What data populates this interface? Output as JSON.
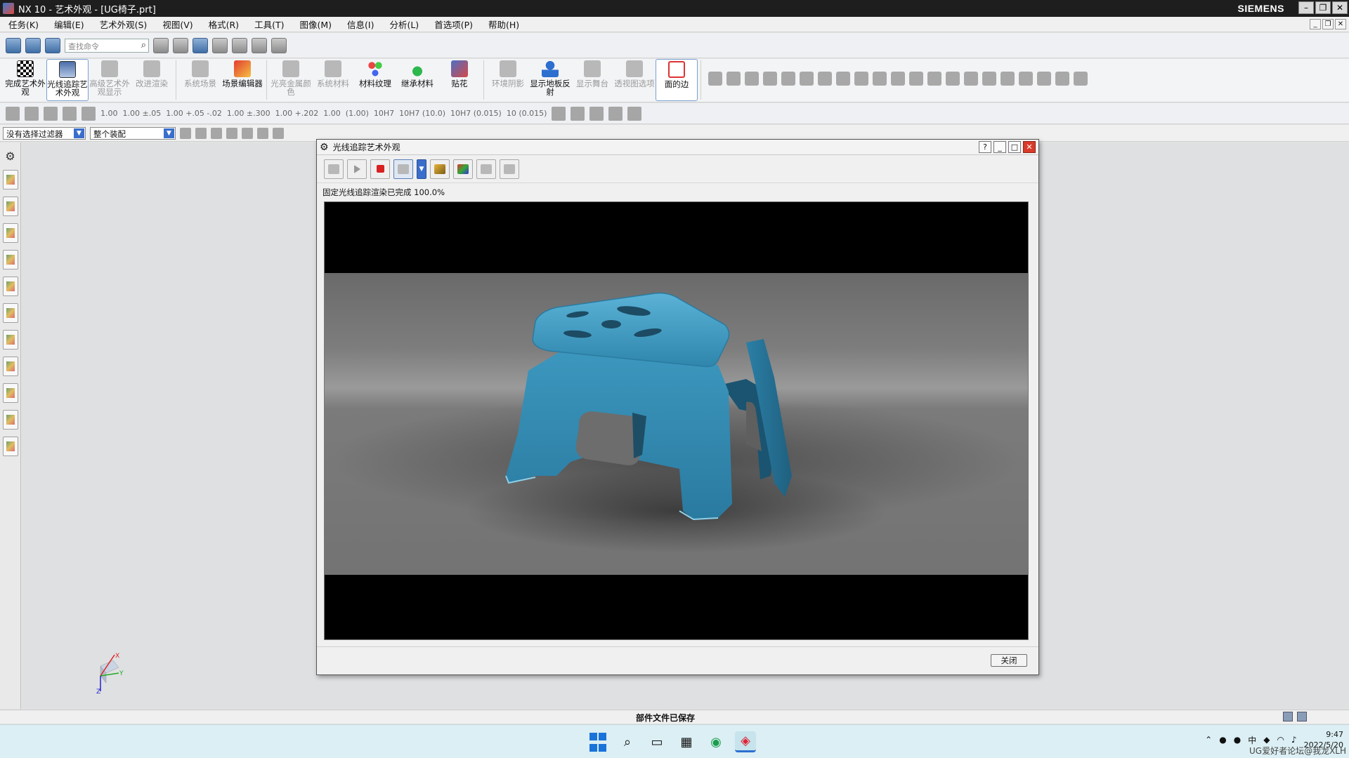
{
  "window": {
    "title": "NX 10 - 艺术外观 - [UG椅子.prt]",
    "brand": "SIEMENS"
  },
  "menu": [
    "任务(K)",
    "编辑(E)",
    "艺术外观(S)",
    "视图(V)",
    "格式(R)",
    "工具(T)",
    "图像(M)",
    "信息(I)",
    "分析(L)",
    "首选项(P)",
    "帮助(H)"
  ],
  "quick": {
    "search_placeholder": "查找命令"
  },
  "ribbon": {
    "buttons": [
      {
        "label": "完成艺术外观",
        "state": "normal",
        "icon": "flag-icon"
      },
      {
        "label": "光线追踪艺术外观",
        "state": "active",
        "icon": "raytrace-icon"
      },
      {
        "label": "高级艺术外观显示",
        "state": "disabled",
        "icon": "display-icon"
      },
      {
        "label": "改进渲染",
        "state": "disabled",
        "icon": "render-icon"
      },
      {
        "label": "系统场景",
        "state": "disabled",
        "icon": "scene-icon"
      },
      {
        "label": "场景编辑器",
        "state": "normal",
        "icon": "scene-editor-icon"
      },
      {
        "label": "光亮金属颜色",
        "state": "disabled",
        "icon": "metal-icon"
      },
      {
        "label": "系统材料",
        "state": "disabled",
        "icon": "material-icon"
      },
      {
        "label": "材料纹理",
        "state": "normal",
        "icon": "texture-icon"
      },
      {
        "label": "继承材料",
        "state": "normal",
        "icon": "inherit-icon"
      },
      {
        "label": "贴花",
        "state": "normal",
        "icon": "decal-icon"
      },
      {
        "label": "环境阴影",
        "state": "disabled",
        "icon": "shadow-icon"
      },
      {
        "label": "显示地板反射",
        "state": "normal",
        "icon": "reflection-icon"
      },
      {
        "label": "显示舞台",
        "state": "disabled",
        "icon": "stage-icon"
      },
      {
        "label": "透视图选项",
        "state": "disabled",
        "icon": "perspective-icon"
      },
      {
        "label": "面的边",
        "state": "active",
        "icon": "face-edge-icon"
      }
    ]
  },
  "row3": {
    "nums": [
      "1.00",
      "1.00 ±.05",
      "1.00 +.05 -.02",
      "1.00 ±.300",
      "1.00 +.202",
      "1.00",
      "(1.00)",
      "10H7",
      "10H7 (10.0)",
      "10H7 (0.015)",
      "10 (0.015)"
    ]
  },
  "filters": {
    "selection_filter": "没有选择过滤器",
    "assembly_scope": "整个装配"
  },
  "dialog": {
    "title": "光线追踪艺术外观",
    "status": "固定光线追踪渲染已完成 100.0%",
    "close_label": "关闭"
  },
  "render_colors": {
    "stool": "#3a8fb5",
    "stool_dark": "#1d5670",
    "floor": "#7a7a7a",
    "background": "#000000"
  },
  "statusbar": {
    "message": "部件文件已保存"
  },
  "taskbar": {
    "time": "9:47",
    "date": "2022/5/20",
    "ime": "中",
    "watermark": "UG爱好者论坛@我龙XLH"
  },
  "triad": {
    "x": "X",
    "y": "Y",
    "z": "Z"
  }
}
